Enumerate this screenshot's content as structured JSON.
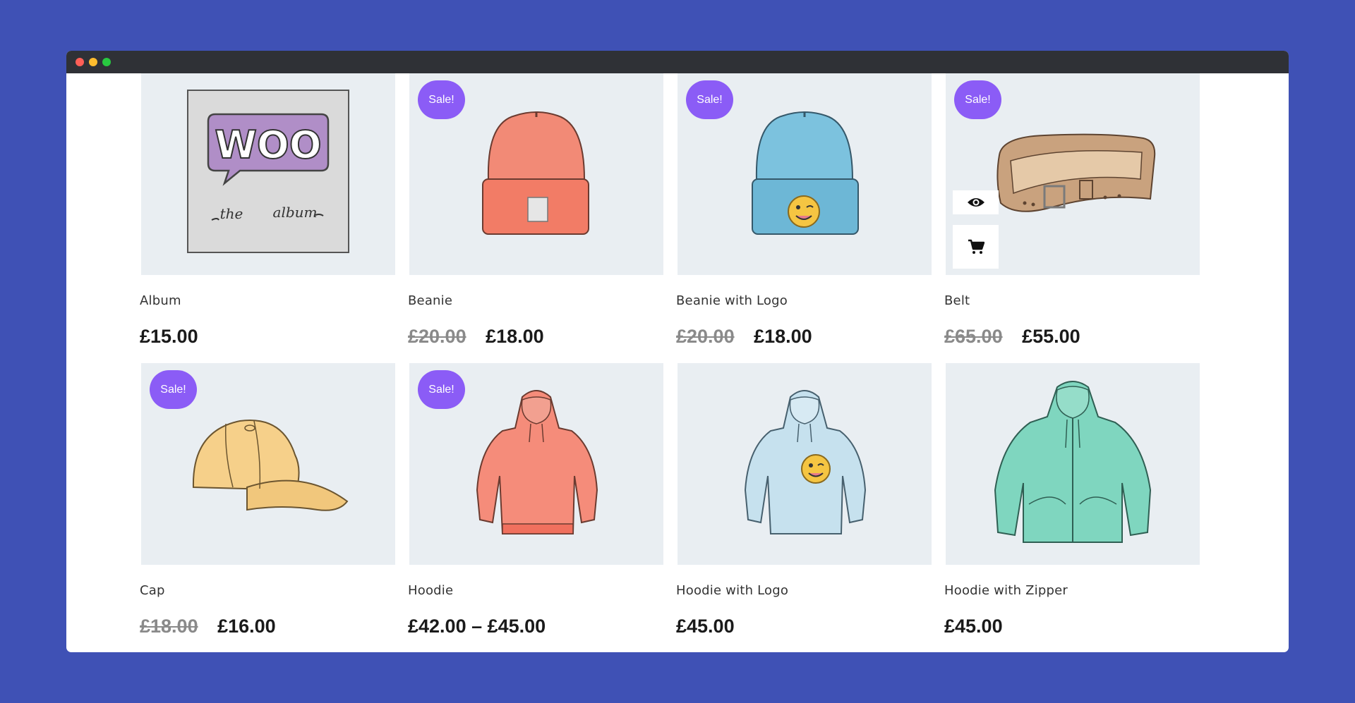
{
  "window": {
    "controls": {
      "close_color": "#ff5f57",
      "minimize_color": "#febc2e",
      "maximize_color": "#28c840"
    }
  },
  "colors": {
    "background": "#3f51b5",
    "sale_badge": "#8b5cf6",
    "thumb_bg": "#e9eef2"
  },
  "products": [
    {
      "name": "Album",
      "price": "£15.00",
      "old_price": "",
      "sale": "",
      "image": "album-art"
    },
    {
      "name": "Beanie",
      "price": "£18.00",
      "old_price": "£20.00",
      "sale": "Sale!",
      "image": "beanie-orange"
    },
    {
      "name": "Beanie with Logo",
      "price": "£18.00",
      "old_price": "£20.00",
      "sale": "Sale!",
      "image": "beanie-blue-logo"
    },
    {
      "name": "Belt",
      "price": "£55.00",
      "old_price": "£65.00",
      "sale": "Sale!",
      "image": "belt"
    },
    {
      "name": "Cap",
      "price": "£16.00",
      "old_price": "£18.00",
      "sale": "Sale!",
      "image": "cap-yellow"
    },
    {
      "name": "Hoodie",
      "price": "£42.00 – £45.00",
      "old_price": "",
      "sale": "Sale!",
      "image": "hoodie-red"
    },
    {
      "name": "Hoodie with Logo",
      "price": "£45.00",
      "old_price": "",
      "sale": "",
      "image": "hoodie-blue-logo"
    },
    {
      "name": "Hoodie with Zipper",
      "price": "£45.00",
      "old_price": "",
      "sale": "",
      "image": "hoodie-green-zipper"
    }
  ],
  "hover_actions": {
    "quick_view_icon": "eye-icon",
    "add_to_cart_icon": "cart-icon"
  },
  "album_art": {
    "logo_text": "WOO",
    "caption_left": "the",
    "caption_right": "album"
  }
}
